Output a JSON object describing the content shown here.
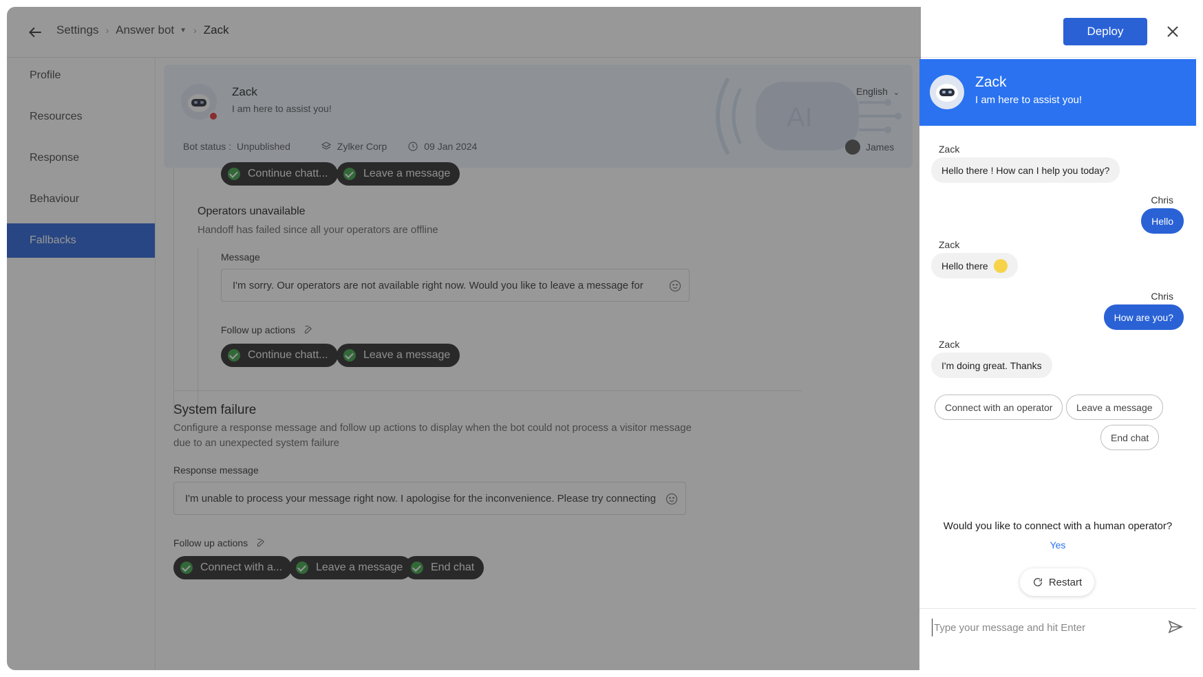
{
  "topbar": {
    "breadcrumbs": [
      "Settings",
      "Answer bot",
      "Zack"
    ],
    "deploy_label": "Deploy"
  },
  "sidebar": {
    "items": [
      {
        "label": "Profile"
      },
      {
        "label": "Resources"
      },
      {
        "label": "Response"
      },
      {
        "label": "Behaviour"
      },
      {
        "label": "Fallbacks"
      }
    ],
    "active": "Fallbacks"
  },
  "bot": {
    "name": "Zack",
    "tagline": "I am here to assist you!",
    "language": "English",
    "status_label": "Bot status :",
    "status_value": "Unpublished",
    "department": "Zylker Corp",
    "date": "09 Jan 2024",
    "owner": "James",
    "art_text": "AI"
  },
  "fallbacks": {
    "top_actions": [
      "Continue chatt...",
      "Leave a message"
    ],
    "operators_unavailable": {
      "title": "Operators unavailable",
      "description": "Handoff has failed since all your operators are offline",
      "message_label": "Message",
      "message_value": "I'm sorry. Our operators are not available right now. Would you like to leave a message for",
      "follow_label": "Follow up actions",
      "actions": [
        "Continue chatt...",
        "Leave a message"
      ]
    },
    "system_failure": {
      "title": "System failure",
      "description_line1": "Configure a response message and follow up actions to display when the bot could not process a visitor message",
      "description_line2": "due to an unexpected system failure",
      "response_label": "Response message",
      "response_value": "I'm unable to process your message right now. I apologise for the inconvenience. Please try connecting",
      "follow_label": "Follow up actions",
      "actions": [
        "Connect with a...",
        "Leave a message",
        "End chat"
      ]
    }
  },
  "chat": {
    "title": "Zack",
    "subtitle": "I am here to assist you!",
    "messages": [
      {
        "sender": "Zack",
        "text": "Hello there ! How can I help you today?"
      },
      {
        "sender": "Chris",
        "text": "Hello"
      },
      {
        "sender": "Zack",
        "text": "Hello there"
      },
      {
        "sender": "Chris",
        "text": "How are you?"
      },
      {
        "sender": "Zack",
        "text": "I'm doing great. Thanks"
      }
    ],
    "options": [
      "Connect with an operator",
      "Leave a message",
      "End chat"
    ],
    "question": "Would you like to connect with a human operator?",
    "yes_label": "Yes",
    "restart_label": "Restart",
    "input_placeholder": "Type your message and hit Enter"
  },
  "colors": {
    "primary": "#2a62d6",
    "chat_header": "#2a72f0",
    "check": "#3fa44a",
    "offline_dot": "#e03434"
  }
}
